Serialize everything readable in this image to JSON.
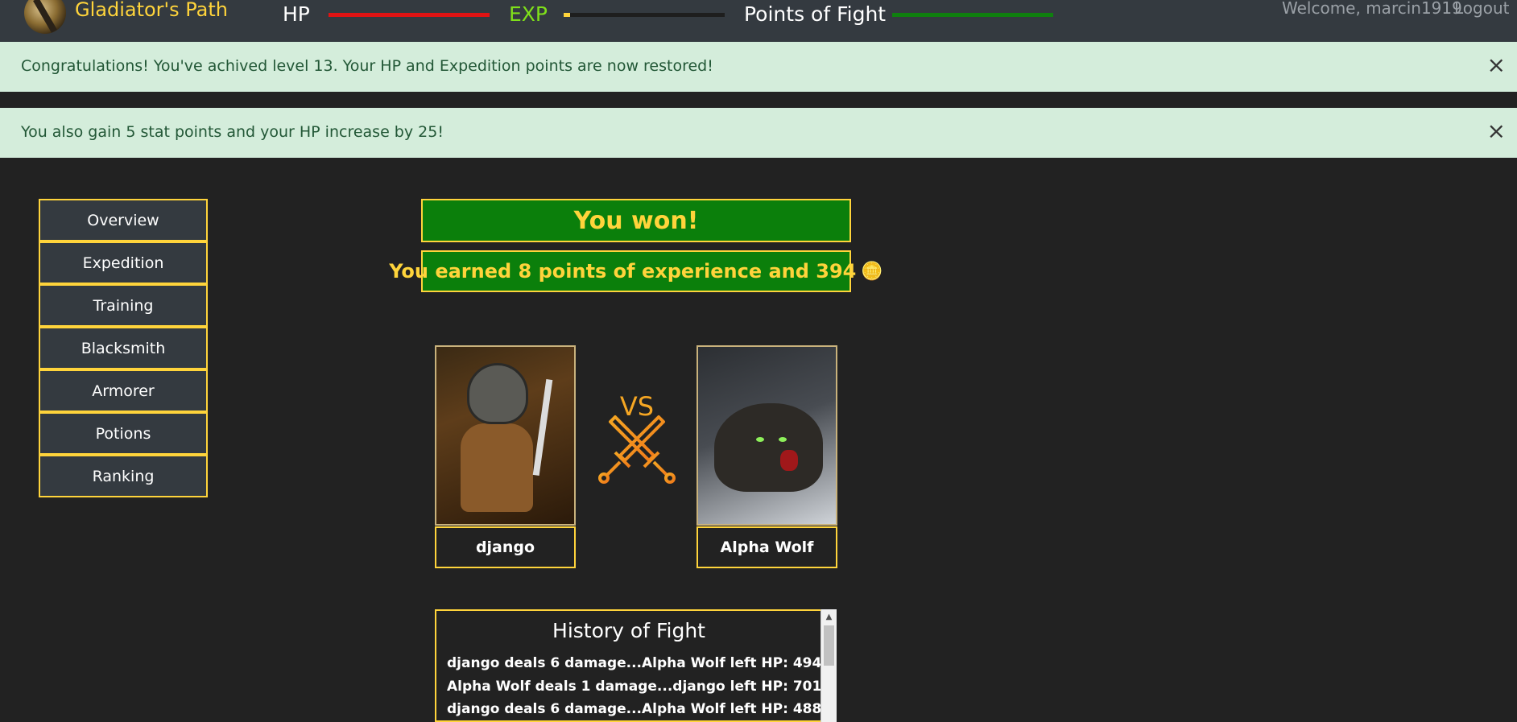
{
  "navbar": {
    "brand": "Gladiator's Path",
    "hp_label": "HP",
    "exp_label": "EXP",
    "exp_progress": 0.04,
    "pof_label": "Points of Fight",
    "welcome": "Welcome, marcin1919",
    "logout": "Logout",
    "colors": {
      "hp": "#e01313",
      "exp": "#ffd43b",
      "pof": "#0f7f0f"
    }
  },
  "alerts": [
    {
      "message": "Congratulations! You've achived level 13. Your HP and Expedition points are now restored!",
      "close": "×"
    },
    {
      "message": "You also gain 5 stat points and your HP increase by 25!",
      "close": "×"
    }
  ],
  "sidebar": {
    "items": [
      {
        "label": "Overview"
      },
      {
        "label": "Expedition"
      },
      {
        "label": "Training"
      },
      {
        "label": "Blacksmith"
      },
      {
        "label": "Armorer"
      },
      {
        "label": "Potions"
      },
      {
        "label": "Ranking"
      }
    ]
  },
  "result": {
    "title": "You won!",
    "earned": "You earned 8 points of experience and 394",
    "coin_icon": "🪙"
  },
  "fight": {
    "player_name": "django",
    "enemy_name": "Alpha Wolf",
    "vs_text": "VS"
  },
  "history": {
    "title": "History of Fight",
    "lines": [
      "django deals 6 damage...Alpha Wolf left HP: 494",
      "Alpha Wolf deals 1 damage...django left HP: 701",
      "django deals 6 damage...Alpha Wolf left HP: 488"
    ]
  }
}
